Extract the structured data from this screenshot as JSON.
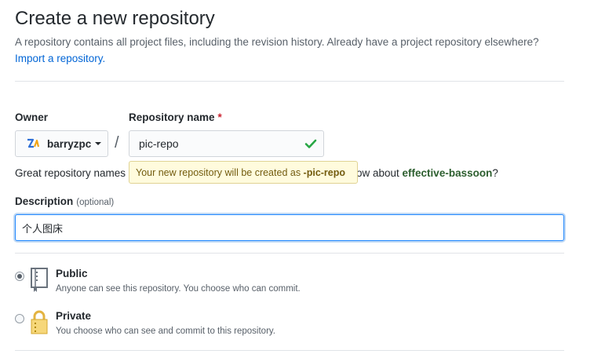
{
  "header": {
    "title": "Create a new repository",
    "subtitle": "A repository contains all project files, including the revision history. Already have a project repository elsewhere?",
    "import_link": "Import a repository."
  },
  "owner": {
    "label": "Owner",
    "value": "barryzpc"
  },
  "repo": {
    "label": "Repository name",
    "required_mark": "*",
    "value": "pic-repo",
    "hint_prefix": "Great repository names",
    "hint_suffix_start": "ow about ",
    "suggestion": "effective-bassoon",
    "hint_suffix_end": "?",
    "tooltip_text": "Your new repository will be created as ",
    "tooltip_name": "-pic-repo"
  },
  "description": {
    "label": "Description",
    "optional": "(optional)",
    "value": "个人图床"
  },
  "visibility": {
    "public": {
      "title": "Public",
      "desc": "Anyone can see this repository. You choose who can commit.",
      "checked": true
    },
    "private": {
      "title": "Private",
      "desc": "You choose who can see and commit to this repository.",
      "checked": false
    }
  },
  "colors": {
    "link": "#0366d6",
    "success_check": "#28a745",
    "tooltip_bg": "#fffbdd",
    "suggestion": "#2c5e2e",
    "focus_border": "#2188ff"
  }
}
